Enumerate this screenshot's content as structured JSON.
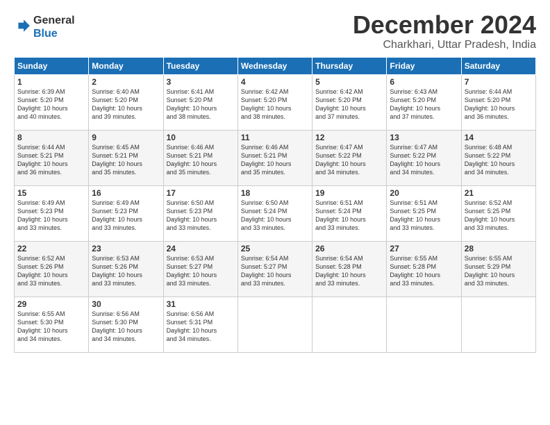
{
  "logo": {
    "line1": "General",
    "line2": "Blue"
  },
  "title": "December 2024",
  "location": "Charkhari, Uttar Pradesh, India",
  "days_of_week": [
    "Sunday",
    "Monday",
    "Tuesday",
    "Wednesday",
    "Thursday",
    "Friday",
    "Saturday"
  ],
  "weeks": [
    [
      {
        "day": "1",
        "info": "Sunrise: 6:39 AM\nSunset: 5:20 PM\nDaylight: 10 hours\nand 40 minutes."
      },
      {
        "day": "2",
        "info": "Sunrise: 6:40 AM\nSunset: 5:20 PM\nDaylight: 10 hours\nand 39 minutes."
      },
      {
        "day": "3",
        "info": "Sunrise: 6:41 AM\nSunset: 5:20 PM\nDaylight: 10 hours\nand 38 minutes."
      },
      {
        "day": "4",
        "info": "Sunrise: 6:42 AM\nSunset: 5:20 PM\nDaylight: 10 hours\nand 38 minutes."
      },
      {
        "day": "5",
        "info": "Sunrise: 6:42 AM\nSunset: 5:20 PM\nDaylight: 10 hours\nand 37 minutes."
      },
      {
        "day": "6",
        "info": "Sunrise: 6:43 AM\nSunset: 5:20 PM\nDaylight: 10 hours\nand 37 minutes."
      },
      {
        "day": "7",
        "info": "Sunrise: 6:44 AM\nSunset: 5:20 PM\nDaylight: 10 hours\nand 36 minutes."
      }
    ],
    [
      {
        "day": "8",
        "info": "Sunrise: 6:44 AM\nSunset: 5:21 PM\nDaylight: 10 hours\nand 36 minutes."
      },
      {
        "day": "9",
        "info": "Sunrise: 6:45 AM\nSunset: 5:21 PM\nDaylight: 10 hours\nand 35 minutes."
      },
      {
        "day": "10",
        "info": "Sunrise: 6:46 AM\nSunset: 5:21 PM\nDaylight: 10 hours\nand 35 minutes."
      },
      {
        "day": "11",
        "info": "Sunrise: 6:46 AM\nSunset: 5:21 PM\nDaylight: 10 hours\nand 35 minutes."
      },
      {
        "day": "12",
        "info": "Sunrise: 6:47 AM\nSunset: 5:22 PM\nDaylight: 10 hours\nand 34 minutes."
      },
      {
        "day": "13",
        "info": "Sunrise: 6:47 AM\nSunset: 5:22 PM\nDaylight: 10 hours\nand 34 minutes."
      },
      {
        "day": "14",
        "info": "Sunrise: 6:48 AM\nSunset: 5:22 PM\nDaylight: 10 hours\nand 34 minutes."
      }
    ],
    [
      {
        "day": "15",
        "info": "Sunrise: 6:49 AM\nSunset: 5:23 PM\nDaylight: 10 hours\nand 33 minutes."
      },
      {
        "day": "16",
        "info": "Sunrise: 6:49 AM\nSunset: 5:23 PM\nDaylight: 10 hours\nand 33 minutes."
      },
      {
        "day": "17",
        "info": "Sunrise: 6:50 AM\nSunset: 5:23 PM\nDaylight: 10 hours\nand 33 minutes."
      },
      {
        "day": "18",
        "info": "Sunrise: 6:50 AM\nSunset: 5:24 PM\nDaylight: 10 hours\nand 33 minutes."
      },
      {
        "day": "19",
        "info": "Sunrise: 6:51 AM\nSunset: 5:24 PM\nDaylight: 10 hours\nand 33 minutes."
      },
      {
        "day": "20",
        "info": "Sunrise: 6:51 AM\nSunset: 5:25 PM\nDaylight: 10 hours\nand 33 minutes."
      },
      {
        "day": "21",
        "info": "Sunrise: 6:52 AM\nSunset: 5:25 PM\nDaylight: 10 hours\nand 33 minutes."
      }
    ],
    [
      {
        "day": "22",
        "info": "Sunrise: 6:52 AM\nSunset: 5:26 PM\nDaylight: 10 hours\nand 33 minutes."
      },
      {
        "day": "23",
        "info": "Sunrise: 6:53 AM\nSunset: 5:26 PM\nDaylight: 10 hours\nand 33 minutes."
      },
      {
        "day": "24",
        "info": "Sunrise: 6:53 AM\nSunset: 5:27 PM\nDaylight: 10 hours\nand 33 minutes."
      },
      {
        "day": "25",
        "info": "Sunrise: 6:54 AM\nSunset: 5:27 PM\nDaylight: 10 hours\nand 33 minutes."
      },
      {
        "day": "26",
        "info": "Sunrise: 6:54 AM\nSunset: 5:28 PM\nDaylight: 10 hours\nand 33 minutes."
      },
      {
        "day": "27",
        "info": "Sunrise: 6:55 AM\nSunset: 5:28 PM\nDaylight: 10 hours\nand 33 minutes."
      },
      {
        "day": "28",
        "info": "Sunrise: 6:55 AM\nSunset: 5:29 PM\nDaylight: 10 hours\nand 33 minutes."
      }
    ],
    [
      {
        "day": "29",
        "info": "Sunrise: 6:55 AM\nSunset: 5:30 PM\nDaylight: 10 hours\nand 34 minutes."
      },
      {
        "day": "30",
        "info": "Sunrise: 6:56 AM\nSunset: 5:30 PM\nDaylight: 10 hours\nand 34 minutes."
      },
      {
        "day": "31",
        "info": "Sunrise: 6:56 AM\nSunset: 5:31 PM\nDaylight: 10 hours\nand 34 minutes."
      },
      {
        "day": "",
        "info": ""
      },
      {
        "day": "",
        "info": ""
      },
      {
        "day": "",
        "info": ""
      },
      {
        "day": "",
        "info": ""
      }
    ]
  ]
}
